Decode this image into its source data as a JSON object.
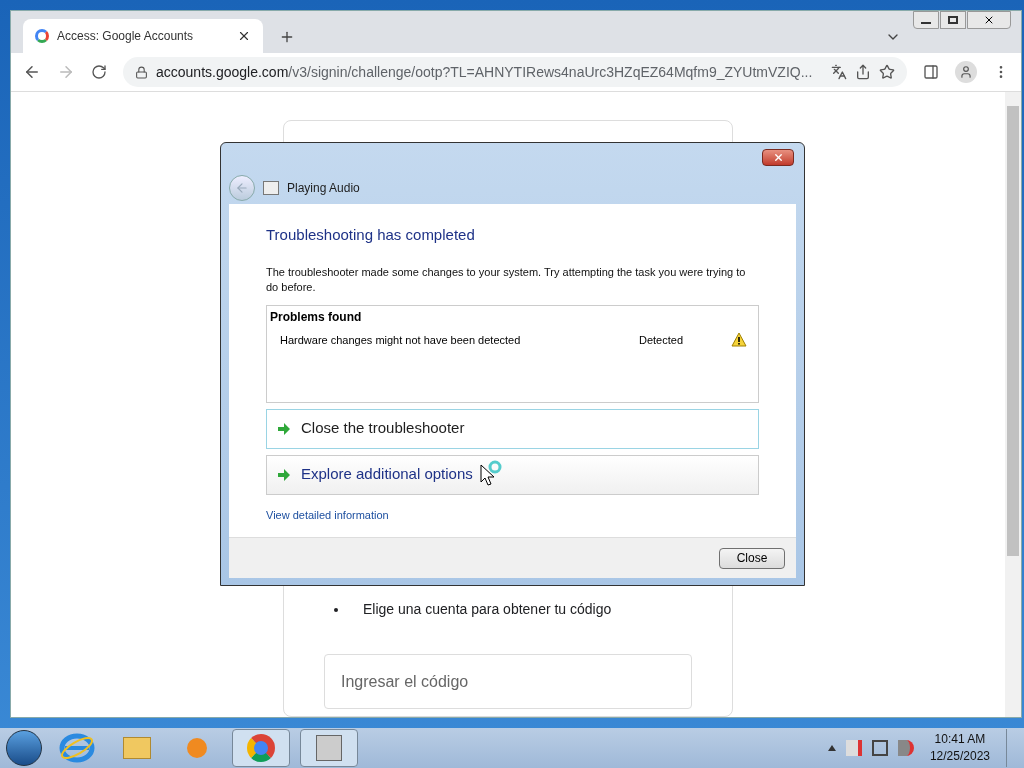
{
  "browser": {
    "tab": {
      "title": "Access: Google Accounts",
      "selected": true
    },
    "address": {
      "host": "accounts.google.com",
      "path": "/v3/signin/challenge/ootp?TL=AHNYTIRews4naUrc3HZqEZ64Mqfm9_ZYUtmVZIQ..."
    }
  },
  "page": {
    "bullets": [
      "Elige una cuenta para obtener tu código"
    ],
    "code_field": {
      "placeholder": "Ingresar el código"
    }
  },
  "dialog": {
    "title": "Playing Audio",
    "heading": "Troubleshooting has completed",
    "message": "The troubleshooter made some changes to your system. Try attempting the task you were trying to do before.",
    "problems": {
      "header": "Problems found",
      "rows": [
        {
          "problem": "Hardware changes might not have been detected",
          "status": "Detected"
        }
      ]
    },
    "options": [
      {
        "label": "Close the troubleshooter",
        "selected": true
      },
      {
        "label": "Explore additional options",
        "selected": false
      }
    ],
    "details_link": "View detailed information",
    "close_button": "Close"
  },
  "taskbar": {
    "time": "10:41 AM",
    "date": "12/25/2023"
  }
}
